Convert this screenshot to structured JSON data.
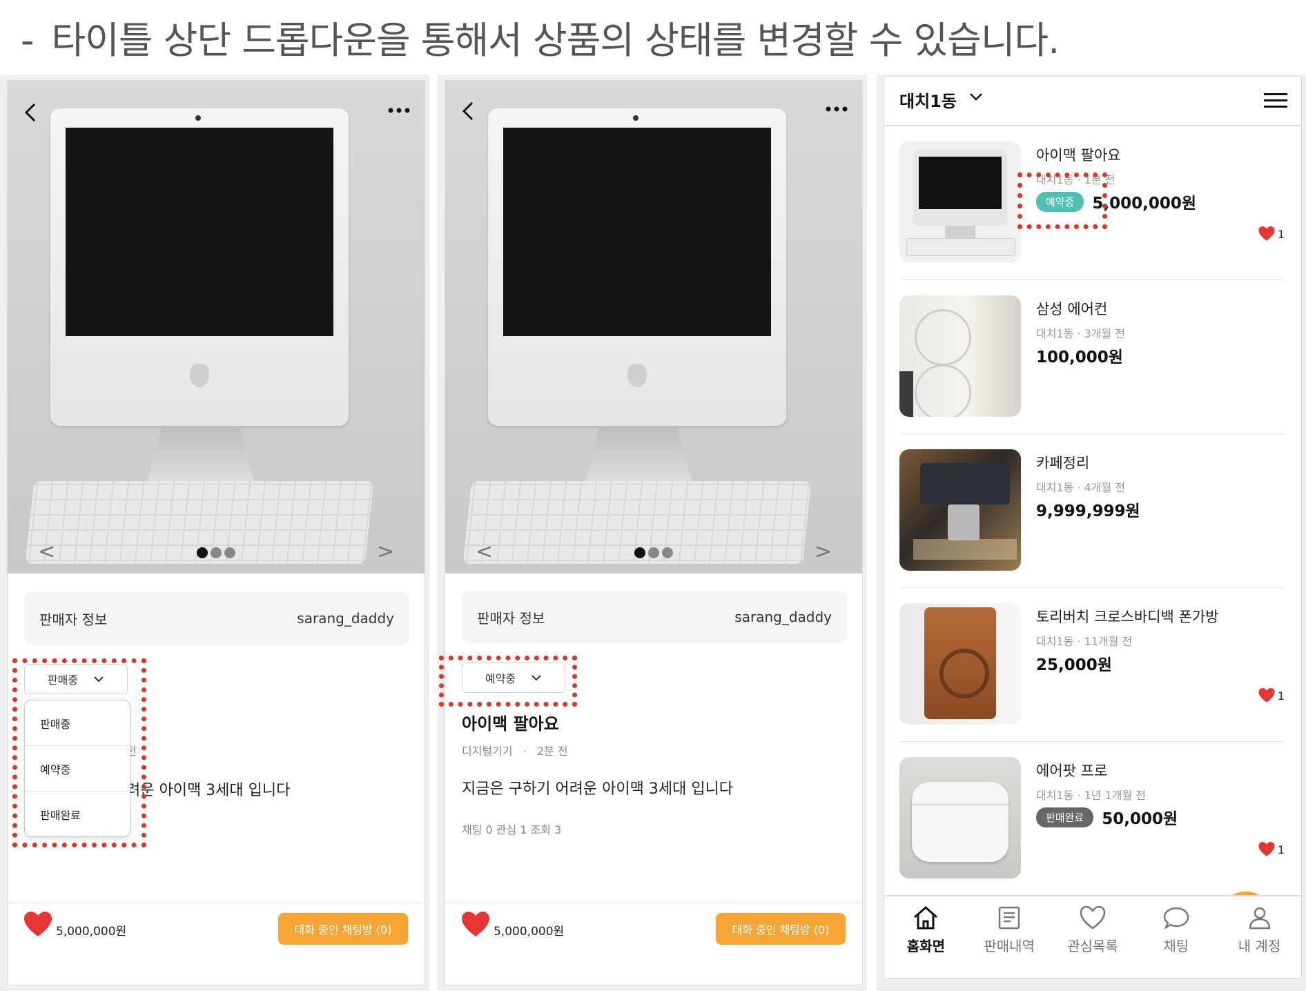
{
  "heading": {
    "dash": "-",
    "text": "타이틀 상단 드롭다운을 통해서 상품의 상태를 변경할 수 있습니다."
  },
  "colors": {
    "accent_orange": "#f4a536",
    "highlight_red": "#d9362a",
    "reserved_badge": "#4fc0b4",
    "sold_badge": "#666666",
    "heart_red": "#e53535"
  },
  "panel1": {
    "seller_label": "판매자 정보",
    "seller_name": "sarang_daddy",
    "status_selected": "판매중",
    "dropdown_options": [
      "판매중",
      "예약중",
      "판매완료"
    ],
    "partial_meta": "전",
    "partial_desc": "려운 아이맥 3세대 입니다",
    "price": "5,000,000원",
    "chat_button": "대화 중인 채팅방 (0)"
  },
  "panel2": {
    "seller_label": "판매자 정보",
    "seller_name": "sarang_daddy",
    "status_selected": "예약중",
    "title": "아이맥 팔아요",
    "category": "디지털기기",
    "separator": "·",
    "time": "2분 전",
    "description": "지금은 구하기 어려운 아이맥 3세대 입니다",
    "stats": "채팅 0  관심 1  조회 3",
    "price": "5,000,000원",
    "chat_button": "대화 중인 채팅방 (0)"
  },
  "panel3": {
    "location": "대치1동",
    "listings": [
      {
        "title": "아이맥 팔아요",
        "meta": "대치1동 · 1분 전",
        "badge": "예약중",
        "price": "5,000,000원",
        "likes": "1",
        "thumb": "imac"
      },
      {
        "title": "삼성 에어컨",
        "meta": "대치1동 · 3개월 전",
        "badge": "",
        "price": "100,000원",
        "likes": "",
        "thumb": "aircon"
      },
      {
        "title": "카페정리",
        "meta": "대치1동 · 4개월 전",
        "badge": "",
        "price": "9,999,999원",
        "likes": "",
        "thumb": "coffee"
      },
      {
        "title": "토리버치 크로스바디백 폰가방",
        "meta": "대치1동 · 11개월 전",
        "badge": "",
        "price": "25,000원",
        "likes": "1",
        "thumb": "bag"
      },
      {
        "title": "에어팟 프로",
        "meta": "대치1동 · 1년 1개월 전",
        "badge": "판매완료",
        "price": "50,000원",
        "likes": "1",
        "thumb": "airpods"
      }
    ],
    "fab_label": "+",
    "tabs": [
      {
        "label": "홈화면",
        "icon": "home-icon",
        "active": true
      },
      {
        "label": "판매내역",
        "icon": "receipt-icon",
        "active": false
      },
      {
        "label": "관심목록",
        "icon": "heart-outline-icon",
        "active": false
      },
      {
        "label": "채팅",
        "icon": "chat-bubble-icon",
        "active": false
      },
      {
        "label": "내 계정",
        "icon": "user-icon",
        "active": false
      }
    ]
  }
}
